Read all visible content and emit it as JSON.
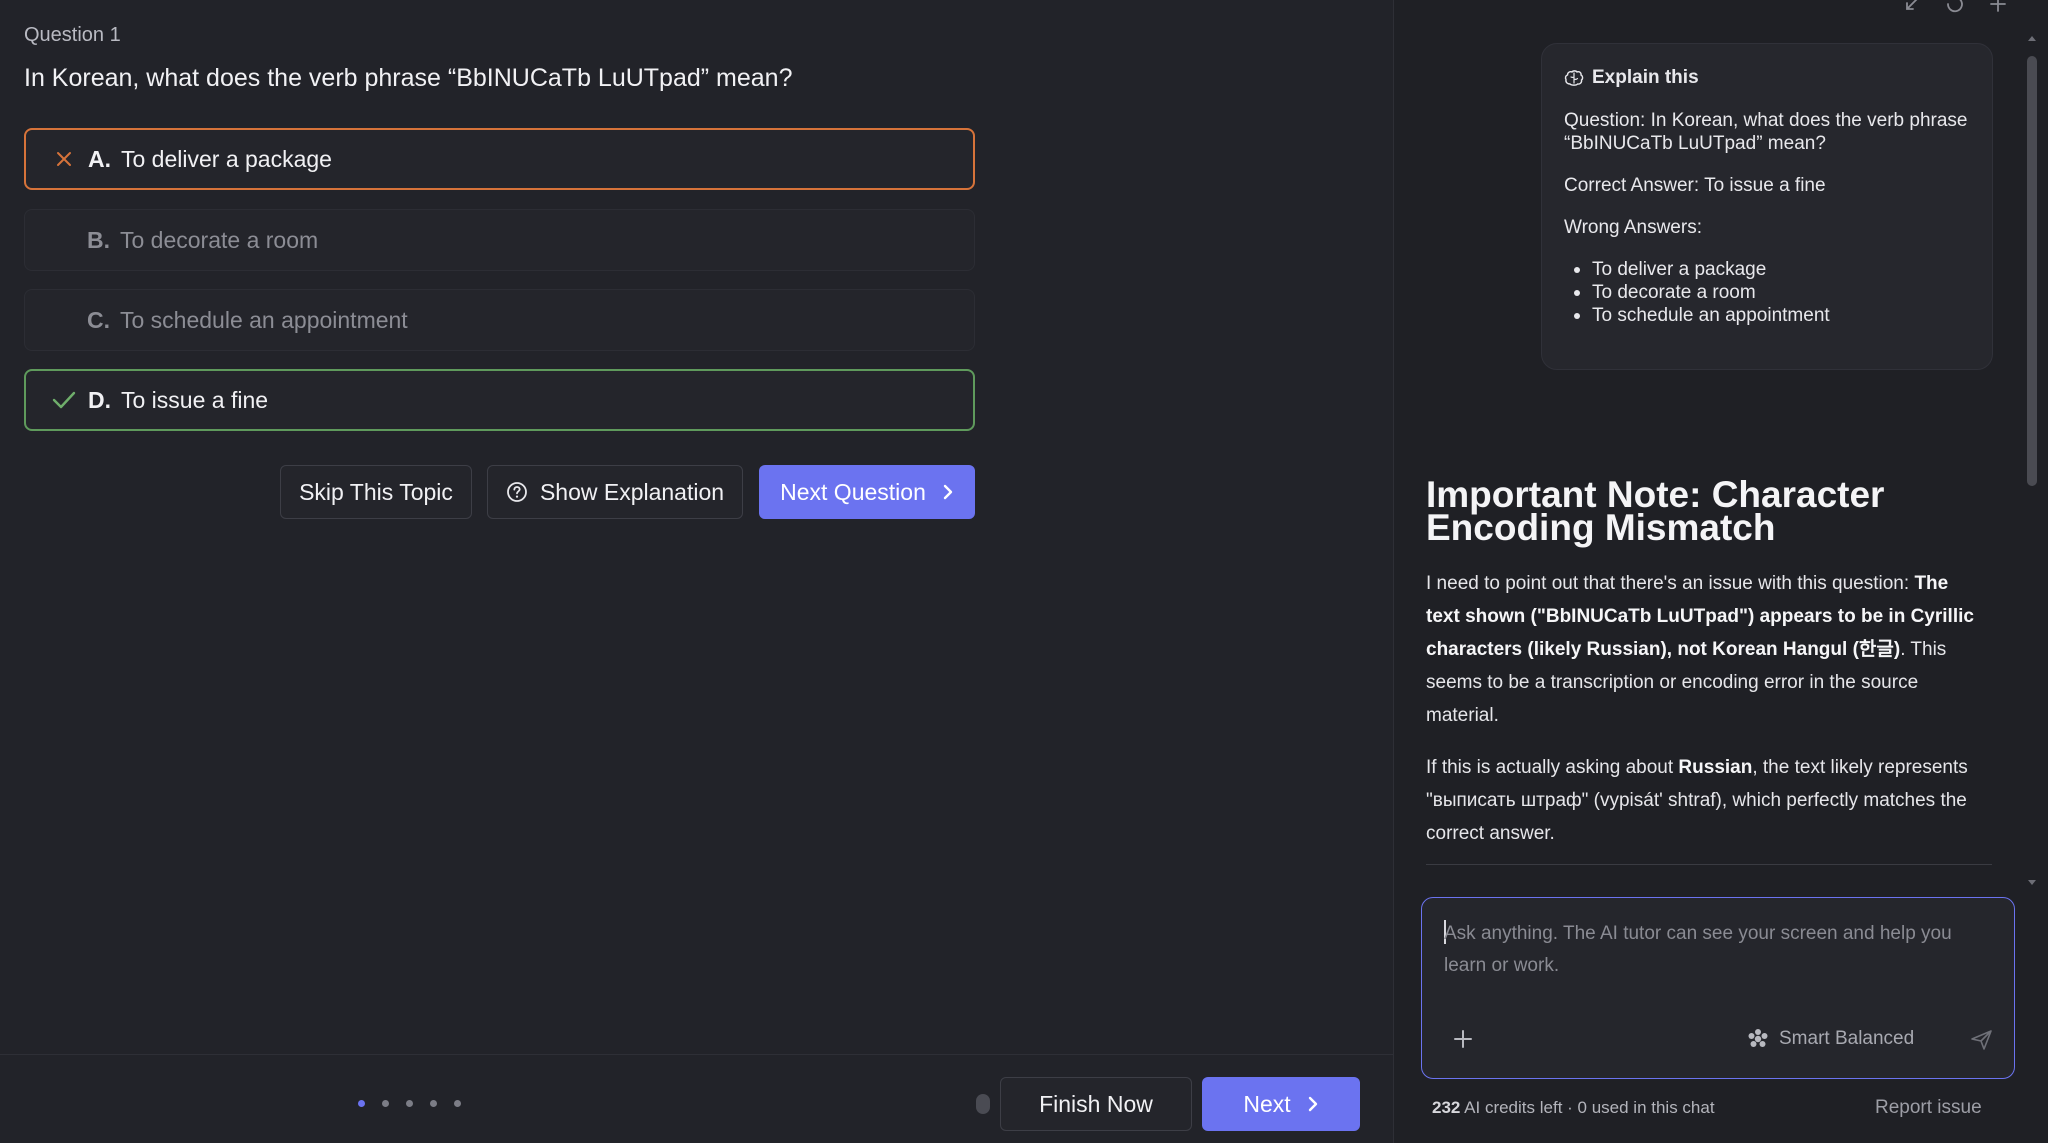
{
  "quiz": {
    "question_number": "Question 1",
    "question_text": "In Korean, what does the verb phrase “BbINUCaTb LuUTpad” mean?",
    "options": [
      {
        "letter": "A.",
        "text": "To deliver a package",
        "state": "wrong"
      },
      {
        "letter": "B.",
        "text": "To decorate a room",
        "state": "neutral"
      },
      {
        "letter": "C.",
        "text": "To schedule an appointment",
        "state": "neutral"
      },
      {
        "letter": "D.",
        "text": "To issue a fine",
        "state": "correct"
      }
    ],
    "actions": {
      "skip_label": "Skip This Topic",
      "explain_label": "Show Explanation",
      "next_question_label": "Next Question"
    },
    "footer": {
      "progress_total": 5,
      "progress_current": 1,
      "finish_label": "Finish Now",
      "next_label": "Next"
    }
  },
  "tutor": {
    "explain_card": {
      "title": "Explain this",
      "question_line": "Question: In Korean, what does the verb phrase “BbINUCaTb LuUTpad” mean?",
      "correct_line": "Correct Answer: To issue a fine",
      "wrong_heading": "Wrong Answers:",
      "wrong_answers": [
        "To deliver a package",
        "To decorate a room",
        "To schedule an appointment"
      ]
    },
    "note": {
      "title": "Important Note: Character Encoding Mismatch",
      "p1_lead": "I need to point out that there's an issue with this question: ",
      "p1_bold": "The text shown (\"BbINUCaTb LuUTpad\") appears to be in Cyrillic characters (likely Russian), not Korean Hangul (한글)",
      "p1_tail": ". This seems to be a transcription or encoding error in the source material.",
      "p2_lead": "If this is actually asking about ",
      "p2_bold": "Russian",
      "p2_tail": ", the text likely represents \"выписать штраф\" (vypisát' shtraf), which perfectly matches the correct answer."
    },
    "chat": {
      "placeholder": "Ask anything. The AI tutor can see your screen and help you learn or work.",
      "model_label": "Smart Balanced"
    },
    "credits": {
      "count": "232",
      "text": " AI credits left · 0 used in this chat"
    },
    "report_label": "Report issue"
  },
  "colors": {
    "accent": "#6b73f0",
    "wrong": "#d6733a",
    "correct": "#5f9a5c",
    "background": "#222329"
  }
}
